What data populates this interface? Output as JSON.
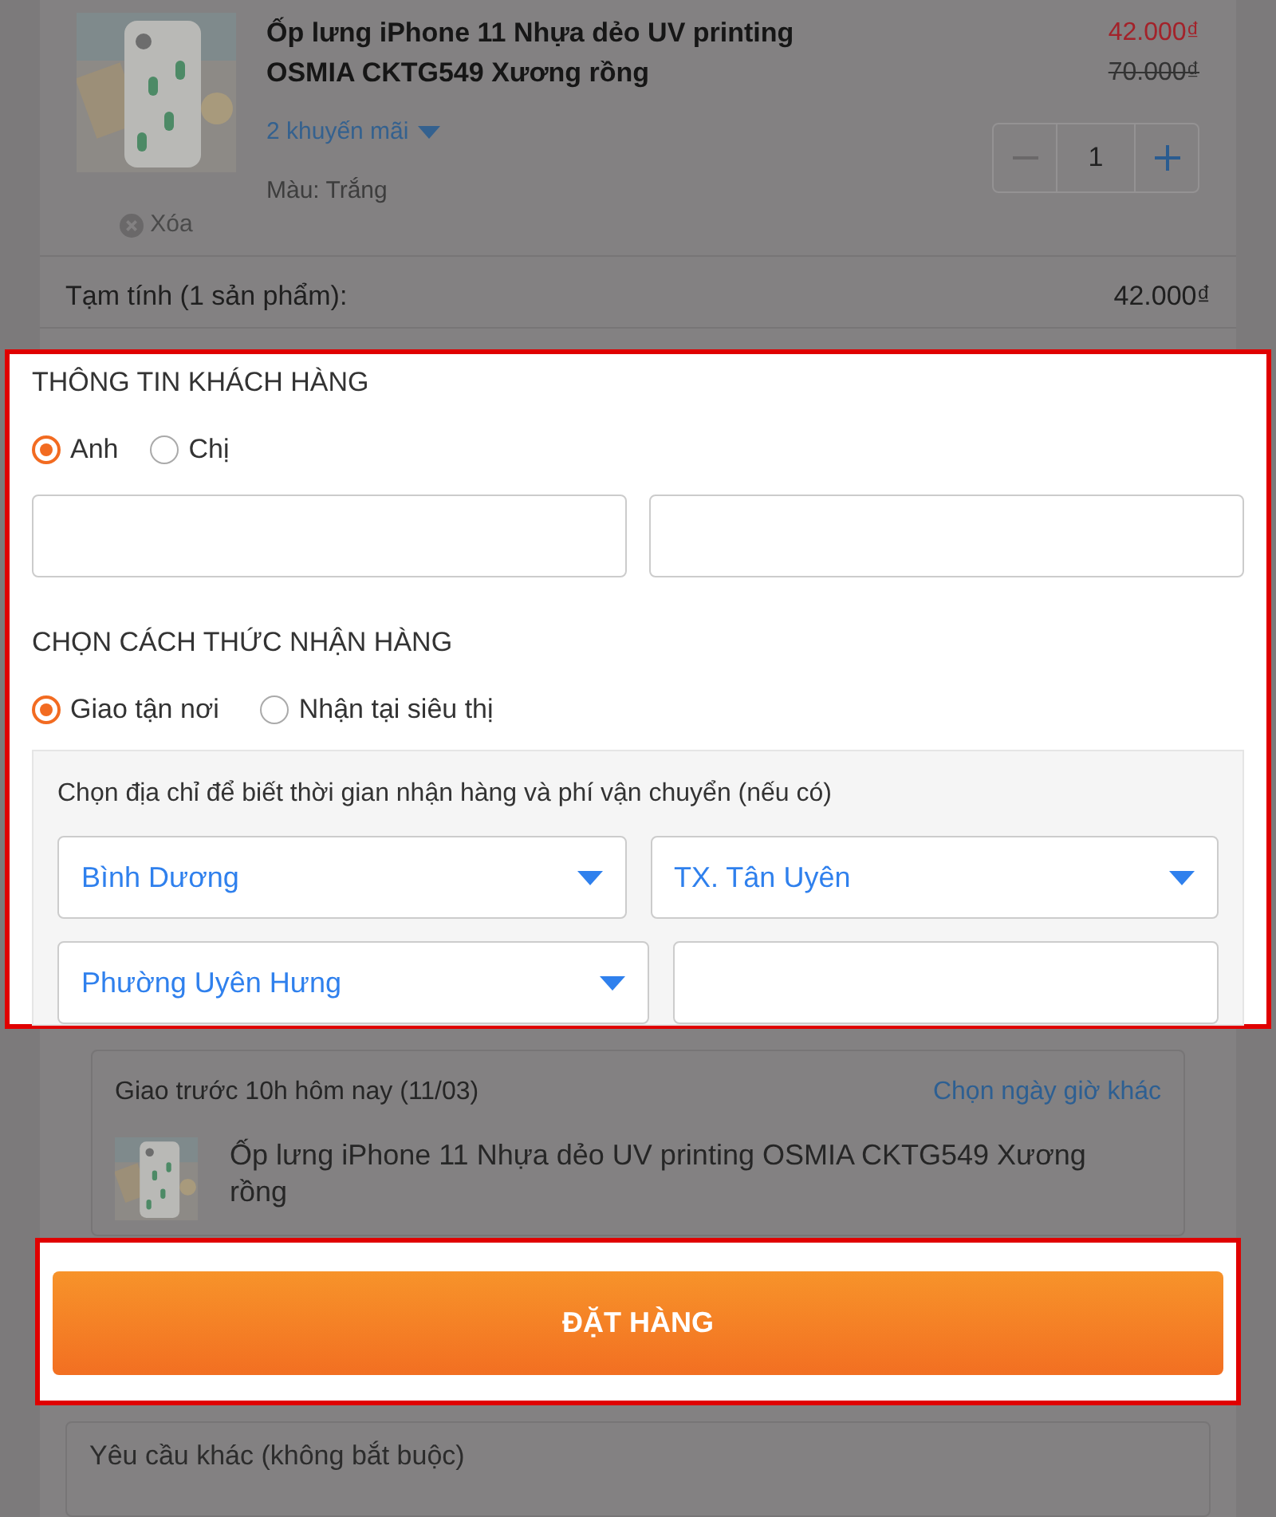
{
  "cart_item": {
    "title": "Ốp lưng iPhone 11 Nhựa dẻo UV printing OSMIA CKTG549 Xương rồng",
    "promotions": "2 khuyến mãi",
    "color_label": "Màu: Trắng",
    "remove": "Xóa",
    "price": "42.000₫",
    "old_price": "70.000₫",
    "quantity": "1"
  },
  "subtotal": {
    "label": "Tạm tính (1 sản phẩm):",
    "value": "42.000₫"
  },
  "customer_info": {
    "heading": "THÔNG TIN KHÁCH HÀNG",
    "salutations": [
      {
        "label": "Anh",
        "selected": true
      },
      {
        "label": "Chị",
        "selected": false
      }
    ]
  },
  "delivery": {
    "heading": "CHỌN CÁCH THỨC NHẬN HÀNG",
    "methods": [
      {
        "label": "Giao tận nơi",
        "selected": true
      },
      {
        "label": "Nhận tại siêu thị",
        "selected": false
      }
    ],
    "address_hint": "Chọn địa chỉ để biết thời gian nhận hàng và phí vận chuyển (nếu có)",
    "selects": [
      "Bình Dương",
      "TX. Tân Uyên",
      "Phường Uyên Hưng"
    ]
  },
  "shipment": {
    "time": "Giao trước 10h hôm nay (11/03)",
    "change_link": "Chọn ngày giờ khác",
    "item_title": "Ốp lưng iPhone 11 Nhựa dẻo UV printing OSMIA CKTG549 Xương rồng"
  },
  "order_button": "ĐẶT HÀNG",
  "other_request": {
    "placeholder": "Yêu cầu khác (không bắt buộc)"
  }
}
